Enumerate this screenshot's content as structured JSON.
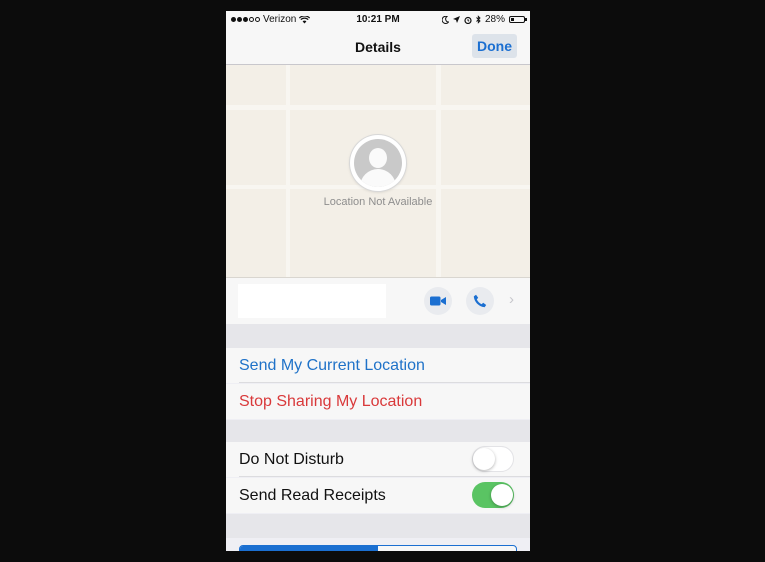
{
  "status_bar": {
    "carrier": "Verizon",
    "time": "10:21 PM",
    "battery": "28%",
    "battery_level": 0.28,
    "signal_bars_filled": 3,
    "signal_bars_total": 5,
    "icons": [
      "wifi-icon",
      "moon-icon",
      "location-arrow-icon",
      "alarm-icon",
      "bluetooth-icon",
      "battery-icon"
    ]
  },
  "nav": {
    "title": "Details",
    "done_label": "Done"
  },
  "map": {
    "location_text": "Location Not Available",
    "avatar_icon": "person-placeholder-icon"
  },
  "contact": {
    "name": "",
    "actions": [
      "video-camera-icon",
      "phone-icon",
      "chevron-right-icon"
    ]
  },
  "location_actions": {
    "send_current": "Send My Current Location",
    "stop_sharing": "Stop Sharing My Location"
  },
  "settings": {
    "do_not_disturb": {
      "label": "Do Not Disturb",
      "on": false
    },
    "send_read_receipts": {
      "label": "Send Read Receipts",
      "on": true
    }
  },
  "colors": {
    "accent_blue": "#1f72c8",
    "destructive_red": "#d9393a",
    "toggle_on_green": "#5ac463"
  }
}
